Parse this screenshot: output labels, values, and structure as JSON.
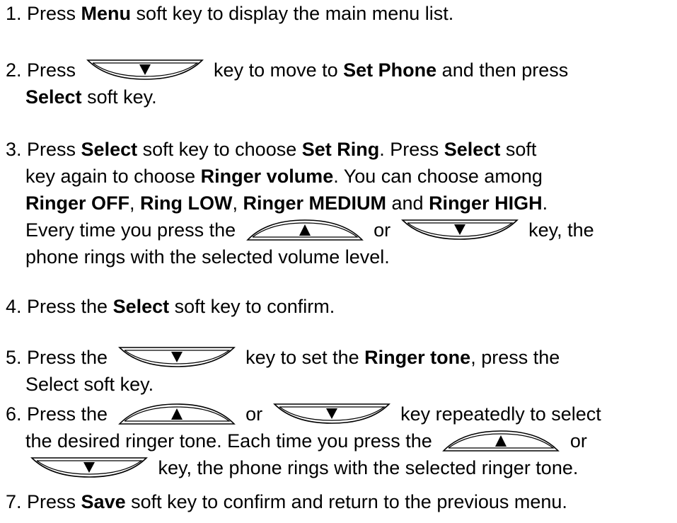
{
  "steps": [
    {
      "lines": [
        [
          {
            "t": "1. Press "
          },
          {
            "b": "Menu"
          },
          {
            "t": " soft key to display the main menu list."
          }
        ]
      ]
    },
    {
      "lines": [
        [
          {
            "t": "2. Press "
          },
          {
            "key": "down"
          },
          {
            "t": " key to move to "
          },
          {
            "b": "Set Phone"
          },
          {
            "t": " and then press"
          }
        ],
        [
          {
            "b": "Select"
          },
          {
            "t": " soft key."
          }
        ]
      ]
    },
    {
      "lines": [
        [
          {
            "t": "3. Press "
          },
          {
            "b": "Select"
          },
          {
            "t": " soft key to choose "
          },
          {
            "b": "Set Ring"
          },
          {
            "t": ". Press "
          },
          {
            "b": "Select"
          },
          {
            "t": " soft"
          }
        ],
        [
          {
            "t": "key again to choose "
          },
          {
            "b": "Ringer volume"
          },
          {
            "t": ". You can choose among"
          }
        ],
        [
          {
            "b": "Ringer OFF"
          },
          {
            "t": ", "
          },
          {
            "b": "Ring LOW"
          },
          {
            "t": ", "
          },
          {
            "b": "Ringer MEDIUM"
          },
          {
            "t": " and "
          },
          {
            "b": "Ringer HIGH"
          },
          {
            "t": "."
          }
        ],
        [
          {
            "t": "Every time you press the "
          },
          {
            "key": "up"
          },
          {
            "t": " or "
          },
          {
            "key": "down"
          },
          {
            "t": " key, the"
          }
        ],
        [
          {
            "t": "phone rings with the selected volume level."
          }
        ]
      ]
    },
    {
      "lines": [
        [
          {
            "t": "4. Press the "
          },
          {
            "b": "Select"
          },
          {
            "t": " soft key to confirm."
          }
        ]
      ]
    },
    {
      "lines": [
        [
          {
            "t": "5. Press the "
          },
          {
            "key": "down"
          },
          {
            "t": " key to set the "
          },
          {
            "b": "Ringer tone"
          },
          {
            "t": ", press the"
          }
        ],
        [
          {
            "t": "Select soft key."
          }
        ]
      ]
    },
    {
      "lines": [
        [
          {
            "t": "6. Press the "
          },
          {
            "key": "up"
          },
          {
            "t": " or "
          },
          {
            "key": "down"
          },
          {
            "t": " key repeatedly to select"
          }
        ],
        [
          {
            "t": "the desired ringer tone. Each time you press the "
          },
          {
            "key": "up"
          },
          {
            "t": " or"
          }
        ],
        [
          {
            "key": "down"
          },
          {
            "t": " key, the phone rings with the selected ringer tone."
          }
        ]
      ]
    },
    {
      "lines": [
        [
          {
            "t": "7. Press "
          },
          {
            "b": "Save"
          },
          {
            "t": " soft key to confirm and return to the previous menu."
          }
        ]
      ]
    }
  ],
  "icons": {
    "up": "up-arrow-key-icon",
    "down": "down-arrow-key-icon"
  }
}
